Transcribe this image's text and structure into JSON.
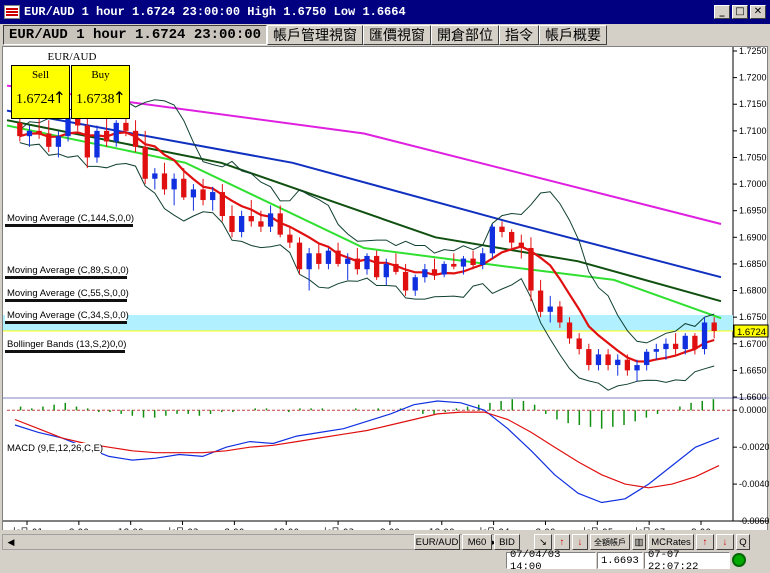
{
  "title": {
    "text": "EUR/AUD 1 hour 1.6724 23:00:00 High 1.6750 Low 1.6664",
    "min_btn": "_",
    "max_btn": "□",
    "close_btn": "✕"
  },
  "tabs": [
    {
      "label": "EUR/AUD 1 hour 1.6724 23:00:00"
    },
    {
      "label": "帳戶管理視窗"
    },
    {
      "label": "匯價視窗"
    },
    {
      "label": "開倉部位"
    },
    {
      "label": "指令"
    },
    {
      "label": "帳戶概要"
    }
  ],
  "price_panel": {
    "symbol": "EUR/AUD",
    "sell_label": "Sell",
    "sell_value": "1.6724",
    "buy_label": "Buy",
    "buy_value": "1.6738",
    "arrow": "↑"
  },
  "indicators": {
    "ma144": "Moving Average (C,144,S,0,0)",
    "ma89": "Moving Average (C,89,S,0,0)",
    "ma55": "Moving Average (C,55,S,0,0)",
    "ma34": "Moving Average (C,34,S,0,0)",
    "bb": "Bollinger Bands (13,S,2)",
    "bb_tail": "0,0)",
    "macd": "MACD (9,E,12,26,C,E)"
  },
  "current_price_label": "1.6724",
  "colors": {
    "ma144": "#e020e0",
    "ma89": "#1030c0",
    "ma55": "#105010",
    "ma34": "#30e030",
    "bb_mid": "#e01010",
    "bb_band": "#104030",
    "bull": "#1030e0",
    "bear": "#e01010",
    "macd_line": "#1030e0",
    "signal_line": "#e01010",
    "hist": "#109010",
    "price_band": "#b0f0ff"
  },
  "chart_data": {
    "type": "candlestick",
    "price_axis_ticks": [
      "1.7250",
      "1.7200",
      "1.7150",
      "1.7100",
      "1.7050",
      "1.7000",
      "1.6950",
      "1.6900",
      "1.6850",
      "1.6800",
      "1.6750",
      "1.6700",
      "1.6650",
      "1.6600"
    ],
    "price_ylim": [
      1.66,
      1.725
    ],
    "macd_axis_ticks": [
      "0.0000",
      "-0.0020",
      "-0.0040",
      "-0.0060"
    ],
    "macd_ylim": [
      -0.006,
      0.0005
    ],
    "x_tick_labels": [
      "七月.01",
      "8:00",
      "18:00",
      "七月.02",
      "8:00",
      "18:00",
      "七月.03",
      "8:00",
      "18:00",
      "七月.04",
      "8:00",
      "七月.05",
      "七月.07",
      "8:00"
    ],
    "ohlc": [
      [
        1.7115,
        1.7135,
        1.708,
        1.709
      ],
      [
        1.709,
        1.711,
        1.707,
        1.71
      ],
      [
        1.71,
        1.713,
        1.7085,
        1.7095
      ],
      [
        1.7095,
        1.712,
        1.706,
        1.707
      ],
      [
        1.707,
        1.71,
        1.705,
        1.709
      ],
      [
        1.709,
        1.714,
        1.708,
        1.7125
      ],
      [
        1.7125,
        1.716,
        1.71,
        1.711
      ],
      [
        1.711,
        1.7125,
        1.703,
        1.705
      ],
      [
        1.705,
        1.711,
        1.704,
        1.71
      ],
      [
        1.71,
        1.713,
        1.707,
        1.708
      ],
      [
        1.708,
        1.712,
        1.707,
        1.7115
      ],
      [
        1.7115,
        1.714,
        1.709,
        1.71
      ],
      [
        1.71,
        1.712,
        1.706,
        1.707
      ],
      [
        1.707,
        1.71,
        1.7,
        1.701
      ],
      [
        1.701,
        1.703,
        1.699,
        1.702
      ],
      [
        1.702,
        1.704,
        1.698,
        1.699
      ],
      [
        1.699,
        1.702,
        1.696,
        1.701
      ],
      [
        1.701,
        1.703,
        1.697,
        1.6975
      ],
      [
        1.6975,
        1.7,
        1.695,
        1.699
      ],
      [
        1.699,
        1.701,
        1.696,
        1.697
      ],
      [
        1.697,
        1.6995,
        1.695,
        1.6985
      ],
      [
        1.6985,
        1.7,
        1.693,
        1.694
      ],
      [
        1.694,
        1.696,
        1.69,
        1.691
      ],
      [
        1.691,
        1.695,
        1.69,
        1.694
      ],
      [
        1.694,
        1.697,
        1.692,
        1.693
      ],
      [
        1.693,
        1.695,
        1.691,
        1.692
      ],
      [
        1.692,
        1.696,
        1.691,
        1.6945
      ],
      [
        1.6945,
        1.696,
        1.69,
        1.6905
      ],
      [
        1.6905,
        1.692,
        1.688,
        1.689
      ],
      [
        1.689,
        1.69,
        1.683,
        1.684
      ],
      [
        1.684,
        1.688,
        1.68,
        1.687
      ],
      [
        1.687,
        1.689,
        1.684,
        1.685
      ],
      [
        1.685,
        1.688,
        1.684,
        1.6875
      ],
      [
        1.6875,
        1.689,
        1.6845,
        1.685
      ],
      [
        1.685,
        1.687,
        1.682,
        1.686
      ],
      [
        1.686,
        1.688,
        1.683,
        1.684
      ],
      [
        1.684,
        1.687,
        1.683,
        1.6865
      ],
      [
        1.6865,
        1.6875,
        1.682,
        1.6825
      ],
      [
        1.6825,
        1.686,
        1.681,
        1.685
      ],
      [
        1.685,
        1.687,
        1.683,
        1.6835
      ],
      [
        1.6835,
        1.685,
        1.679,
        1.68
      ],
      [
        1.68,
        1.683,
        1.679,
        1.6825
      ],
      [
        1.6825,
        1.685,
        1.6815,
        1.684
      ],
      [
        1.684,
        1.686,
        1.682,
        1.683
      ],
      [
        1.683,
        1.6855,
        1.6825,
        1.685
      ],
      [
        1.685,
        1.687,
        1.684,
        1.6845
      ],
      [
        1.6845,
        1.6865,
        1.683,
        1.686
      ],
      [
        1.686,
        1.6875,
        1.684,
        1.6848
      ],
      [
        1.6848,
        1.688,
        1.684,
        1.687
      ],
      [
        1.687,
        1.6925,
        1.686,
        1.692
      ],
      [
        1.692,
        1.693,
        1.69,
        1.691
      ],
      [
        1.691,
        1.6915,
        1.688,
        1.689
      ],
      [
        1.689,
        1.6905,
        1.686,
        1.688
      ],
      [
        1.688,
        1.69,
        1.678,
        1.68
      ],
      [
        1.68,
        1.682,
        1.675,
        1.676
      ],
      [
        1.676,
        1.679,
        1.674,
        1.677
      ],
      [
        1.677,
        1.678,
        1.673,
        1.674
      ],
      [
        1.674,
        1.675,
        1.67,
        1.671
      ],
      [
        1.671,
        1.672,
        1.668,
        1.669
      ],
      [
        1.669,
        1.67,
        1.665,
        1.666
      ],
      [
        1.666,
        1.669,
        1.665,
        1.668
      ],
      [
        1.668,
        1.669,
        1.665,
        1.666
      ],
      [
        1.666,
        1.668,
        1.664,
        1.667
      ],
      [
        1.667,
        1.668,
        1.664,
        1.665
      ],
      [
        1.665,
        1.667,
        1.663,
        1.666
      ],
      [
        1.666,
        1.669,
        1.665,
        1.6685
      ],
      [
        1.6685,
        1.67,
        1.667,
        1.669
      ],
      [
        1.669,
        1.671,
        1.667,
        1.67
      ],
      [
        1.67,
        1.672,
        1.668,
        1.669
      ],
      [
        1.669,
        1.672,
        1.668,
        1.6715
      ],
      [
        1.6715,
        1.672,
        1.668,
        1.669
      ],
      [
        1.669,
        1.675,
        1.668,
        1.674
      ],
      [
        1.674,
        1.675,
        1.671,
        1.6724
      ]
    ],
    "ma144": [
      [
        0,
        1.7185
      ],
      [
        0.5,
        1.7095
      ],
      [
        1,
        1.6925
      ]
    ],
    "ma89": [
      [
        0,
        1.7138
      ],
      [
        0.4,
        1.704
      ],
      [
        0.7,
        1.693
      ],
      [
        1,
        1.6825
      ]
    ],
    "ma55": [
      [
        0,
        1.712
      ],
      [
        0.3,
        1.704
      ],
      [
        0.6,
        1.69
      ],
      [
        0.8,
        1.6855
      ],
      [
        1,
        1.678
      ]
    ],
    "ma34": [
      [
        0,
        1.711
      ],
      [
        0.25,
        1.704
      ],
      [
        0.5,
        1.688
      ],
      [
        0.7,
        1.6845
      ],
      [
        0.85,
        1.682
      ],
      [
        1,
        1.6748
      ]
    ],
    "macd_hist": [
      0.0002,
      0.0001,
      0.0002,
      0.0003,
      0.0004,
      0.0002,
      0.0001,
      -0.0001,
      -0.0001,
      -0.0002,
      -0.0003,
      -0.0004,
      -0.0004,
      -0.0003,
      -0.0002,
      -0.0002,
      -0.0003,
      -0.0002,
      -0.0001,
      -0.0001,
      0.0,
      0.0001,
      0.0001,
      0.0,
      -0.0001,
      0.0001,
      0.0001,
      0.0001,
      0.0,
      0.0,
      0.0001,
      0.0,
      0.0001,
      0.0,
      0.0001,
      0.0,
      -0.0002,
      -0.0002,
      -0.0001,
      0.0001,
      0.0002,
      0.0003,
      0.0004,
      0.0005,
      0.0006,
      0.0005,
      0.0003,
      -0.0002,
      -0.0005,
      -0.0007,
      -0.0008,
      -0.0009,
      -0.001,
      -0.0009,
      -0.0008,
      -0.0006,
      -0.0004,
      -0.0002,
      0.0,
      0.0002,
      0.0004,
      0.0005,
      0.0006
    ],
    "macd_line": [
      -0.0008,
      -0.0012,
      -0.0015,
      -0.002,
      -0.0025,
      -0.0027,
      -0.0026,
      -0.0024,
      -0.0025,
      -0.002,
      -0.0017,
      -0.0018,
      -0.0014,
      -0.0012,
      -0.001,
      -0.0006,
      -0.0002,
      0.0003,
      0.0005,
      0.0004,
      0.0,
      -0.001,
      -0.0022,
      -0.0035,
      -0.0045,
      -0.005,
      -0.0048,
      -0.004,
      -0.003,
      -0.002,
      -0.0015
    ],
    "signal_line": [
      -0.0005,
      -0.001,
      -0.0015,
      -0.0018,
      -0.002,
      -0.0022,
      -0.0023,
      -0.0023,
      -0.0023,
      -0.0022,
      -0.002,
      -0.0019,
      -0.0017,
      -0.0015,
      -0.0013,
      -0.0011,
      -0.0008,
      -0.0005,
      -0.0002,
      -0.0001,
      -0.0001,
      -0.0005,
      -0.0012,
      -0.002,
      -0.0028,
      -0.0035,
      -0.004,
      -0.0042,
      -0.004,
      -0.0036,
      -0.003
    ]
  },
  "status": {
    "symbol_btn": "EUR/AUD",
    "period_btn": "M60",
    "side_btn": "BID",
    "ask_btn": "全額帳戶",
    "rates_btn": "MCRates",
    "q_btn": "Q",
    "date": "07/04/03 14:00",
    "price": "1.6693",
    "clock": "07-07 22:07:22"
  }
}
